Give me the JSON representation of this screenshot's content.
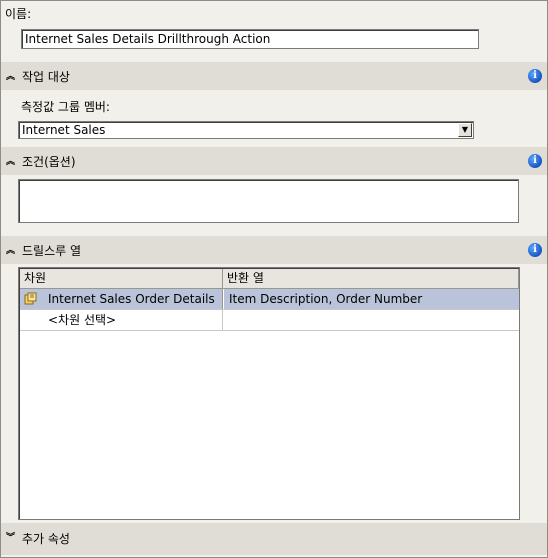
{
  "name_section": {
    "label": "이름:",
    "value": "Internet Sales Details Drillthrough Action"
  },
  "target_section": {
    "title": "작업 대상",
    "measure_group_label": "측정값 그룹 멤버:",
    "measure_group_value": "Internet Sales"
  },
  "condition_section": {
    "title": "조건(옵션)",
    "value": ""
  },
  "drillthrough_section": {
    "title": "드릴스루 열",
    "columns": [
      "차원",
      "반환 열"
    ],
    "rows": [
      {
        "dimension": "Internet Sales Order Details",
        "return_columns": "Item Description, Order Number"
      },
      {
        "dimension": "<차원 선택>",
        "return_columns": ""
      }
    ]
  },
  "extra_section": {
    "title": "추가 속성"
  },
  "icons": {
    "info": "info-icon",
    "collapse": "collapse-chevron-icon",
    "expand": "expand-chevron-icon",
    "dimension": "dimension-icon",
    "dropdown": "dropdown-arrow-icon"
  },
  "colors": {
    "panel_bg": "#f2f0ea",
    "header_bg": "#e0ddd6",
    "selected_row": "#b9c4da",
    "info_blue": "#1555c0"
  }
}
